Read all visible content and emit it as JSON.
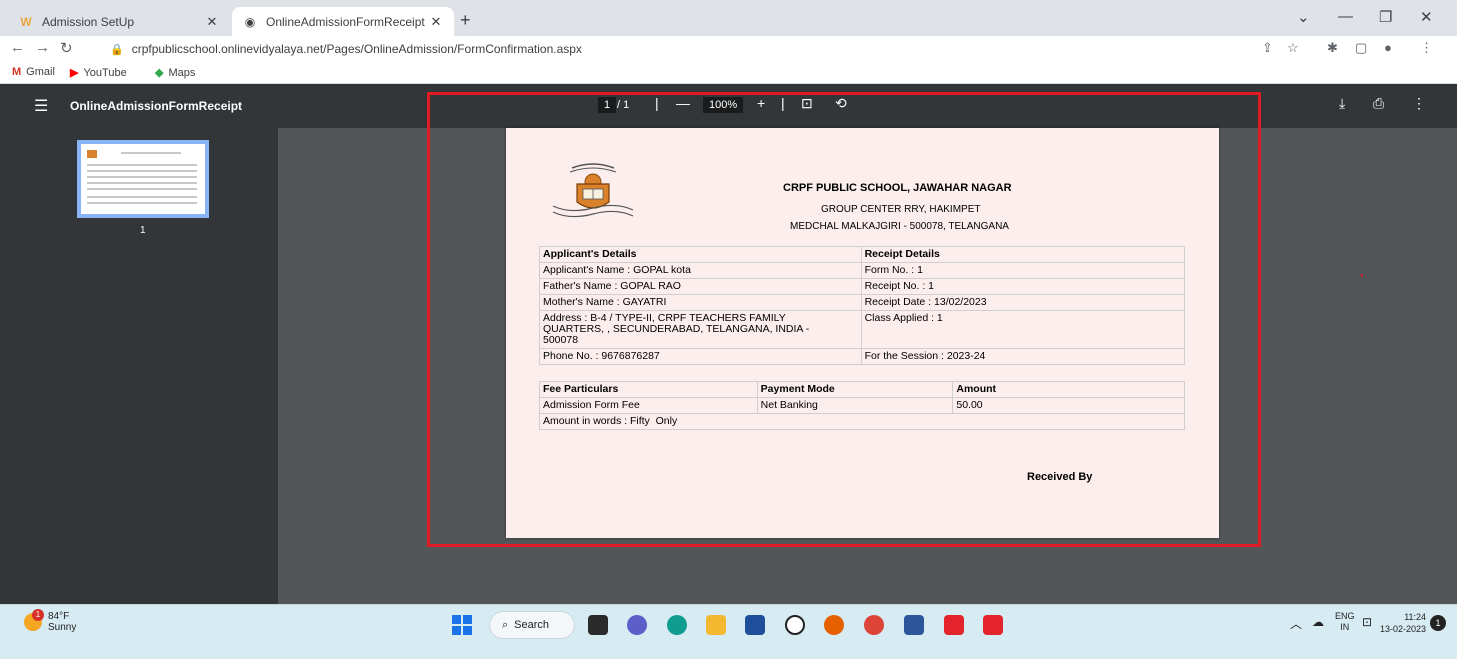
{
  "browser": {
    "tabs": [
      {
        "label": "Admission SetUp",
        "icon": "w-logo-icon"
      },
      {
        "label": "OnlineAdmissionFormReceipt",
        "icon": "globe-icon"
      }
    ],
    "url": "crpfpublicschool.onlinevidyalaya.net/Pages/OnlineAdmission/FormConfirmation.aspx",
    "bookmarks": [
      "Gmail",
      "YouTube",
      "Maps"
    ]
  },
  "pdf_viewer": {
    "title": "OnlineAdmissionFormReceipt",
    "current_page": "1",
    "total_pages": "/ 1",
    "zoom": "100%",
    "thumb_label": "1"
  },
  "receipt": {
    "school_name": "CRPF PUBLIC SCHOOL, JAWAHAR NAGAR",
    "address_line1": "GROUP CENTER RRY, HAKIMPET",
    "address_line2": "MEDCHAL MALKAJGIRI - 500078, TELANGANA",
    "applicant_header": "Applicant's Details",
    "receipt_header": "Receipt Details",
    "applicant_name": "Applicant's Name : GOPAL kota",
    "form_no": "Form No. : 1",
    "father_name": "Father's Name : GOPAL RAO",
    "receipt_no": "Receipt No. : 1",
    "mother_name": "Mother's Name : GAYATRI",
    "receipt_date": "Receipt Date : 13/02/2023",
    "address": "Address : B-4 / TYPE-II, CRPF TEACHERS FAMILY QUARTERS, , SECUNDERABAD, TELANGANA, INDIA - 500078",
    "class_applied": "Class Applied : 1",
    "phone": "Phone No. : 9676876287",
    "session": "For the Session : 2023-24",
    "fee_headers": [
      "Fee Particulars",
      "Payment Mode",
      "Amount"
    ],
    "fee_row": [
      "Admission Form Fee",
      "Net Banking",
      "50.00"
    ],
    "amount_words": "Amount in words : Fifty  Only",
    "received_by": "Received By"
  },
  "taskbar": {
    "temperature": "84°F",
    "weather": "Sunny",
    "weather_badge": "1",
    "search": "Search",
    "lang": "ENG",
    "lang_sub": "IN",
    "time": "11:24",
    "date": "13-02-2023",
    "notifications": "1"
  },
  "colors": {
    "highlight_box": "#e01b24",
    "pdf_toolbar": "#323639",
    "page_bg": "#fdeeee"
  }
}
